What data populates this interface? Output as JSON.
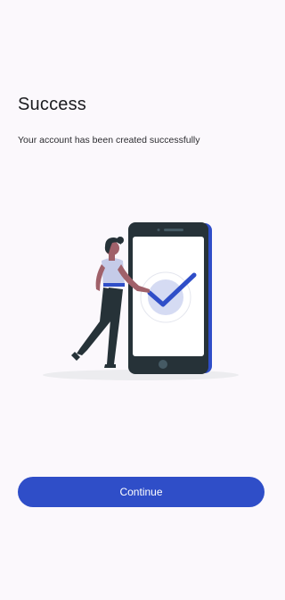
{
  "screen": {
    "title": "Success",
    "message": "Your account has been created successfully",
    "continue_label": "Continue"
  },
  "colors": {
    "accent": "#2f4ec8",
    "background": "#fbf8fc",
    "phone_body": "#263238",
    "check_circle": "#d5dbf3"
  },
  "illustration": {
    "name": "success-checkmark-illustration"
  }
}
